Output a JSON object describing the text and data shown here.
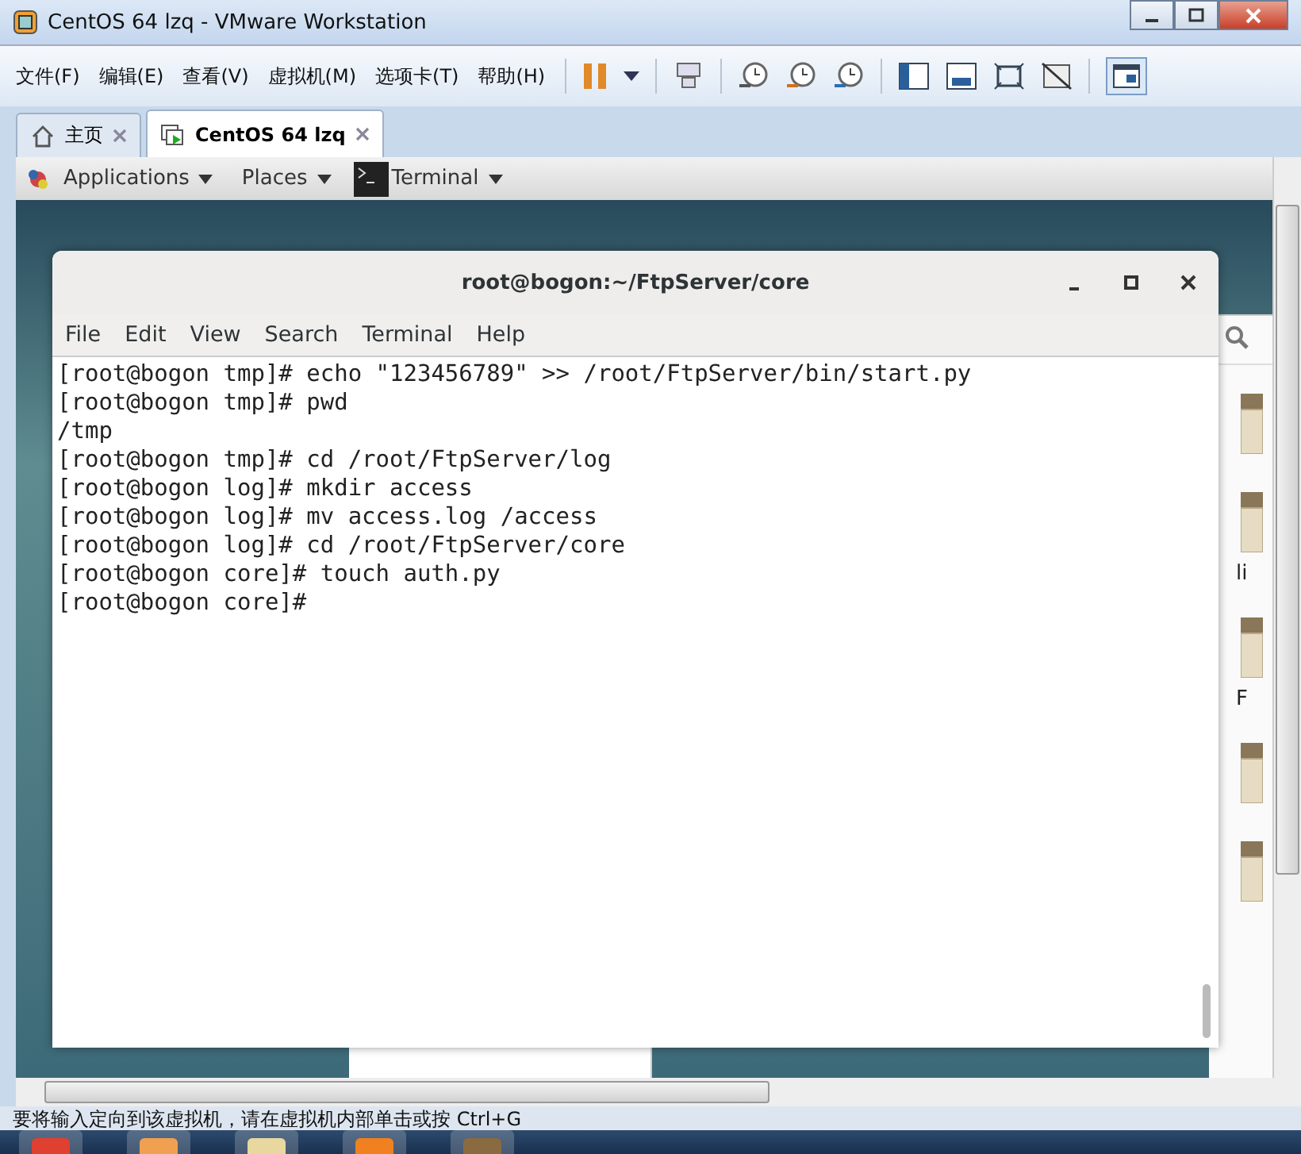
{
  "window": {
    "title": "CentOS 64 lzq - VMware Workstation"
  },
  "menu": [
    "文件(F)",
    "编辑(E)",
    "查看(V)",
    "虚拟机(M)",
    "选项卡(T)",
    "帮助(H)"
  ],
  "tabs": [
    {
      "label": "主页",
      "selected": false
    },
    {
      "label": "CentOS 64 lzq",
      "selected": true
    }
  ],
  "guest_top_bar": {
    "items": [
      "Applications",
      "Places",
      "Terminal"
    ]
  },
  "terminal": {
    "title": "root@bogon:~/FtpServer/core",
    "menu": [
      "File",
      "Edit",
      "View",
      "Search",
      "Terminal",
      "Help"
    ],
    "lines": [
      "[root@bogon tmp]# echo \"123456789\" >> /root/FtpServer/bin/start.py",
      "[root@bogon tmp]# pwd",
      "/tmp",
      "[root@bogon tmp]# cd /root/FtpServer/log",
      "[root@bogon log]# mkdir access",
      "[root@bogon log]# mv access.log /access",
      "[root@bogon log]# cd /root/FtpServer/core",
      "[root@bogon core]# touch auth.py",
      "[root@bogon core]#"
    ]
  },
  "file_manager": {
    "labels": [
      "li",
      "F"
    ]
  },
  "status_bar": "要将输入定向到该虚拟机，请在虚拟机内部单击或按 Ctrl+G"
}
